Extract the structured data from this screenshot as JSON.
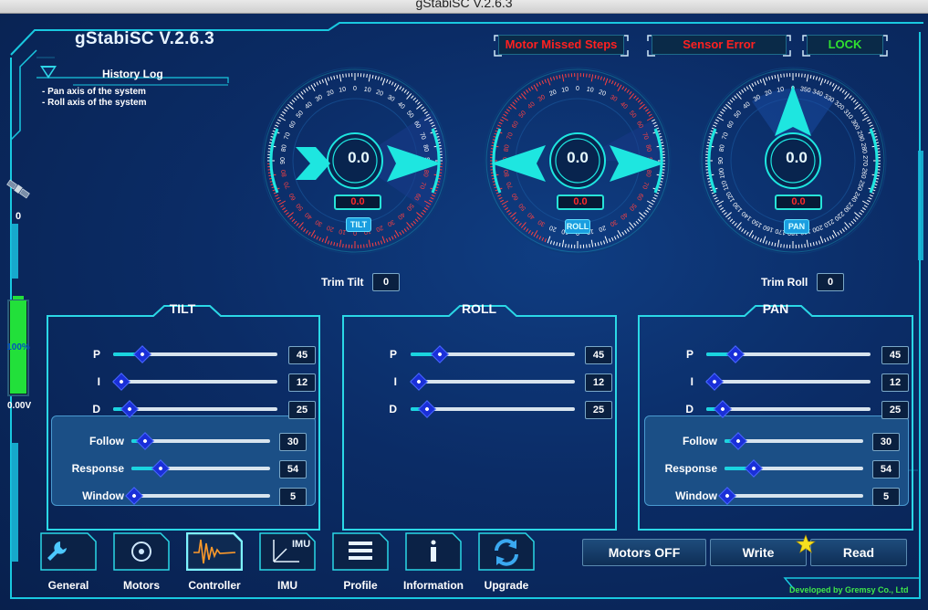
{
  "window": {
    "title": "gStabiSC V.2.6.3"
  },
  "app": {
    "title": "gStabiSC V.2.6.3",
    "credit": "Developed by Gremsy Co., Ltd"
  },
  "status": {
    "motor_missed": "Motor Missed Steps",
    "sensor_error": "Sensor Error",
    "lock": "LOCK"
  },
  "history": {
    "label": "History Log",
    "lines": [
      "- Pan axis of the system",
      "- Roll axis of the system"
    ]
  },
  "left": {
    "satellite_count": "0",
    "battery_percent": "100%",
    "battery_fraction": 1.0,
    "voltage": "0.00V"
  },
  "gauges": {
    "tilt": {
      "value": "0.0",
      "sub": "0.0",
      "tag": "TILT",
      "angle": 0
    },
    "roll": {
      "value": "0.0",
      "sub": "0.0",
      "tag": "ROLL",
      "angle": 0
    },
    "pan": {
      "value": "0.0",
      "sub": "0.0",
      "tag": "PAN",
      "angle": 0
    }
  },
  "trim": {
    "tilt_label": "Trim Tilt",
    "tilt_value": "0",
    "roll_label": "Trim Roll",
    "roll_value": "0"
  },
  "panels": {
    "tilt": {
      "title": "TILT",
      "pid": [
        {
          "label": "P",
          "value": "45",
          "level": 0.18
        },
        {
          "label": "I",
          "value": "12",
          "level": 0.05
        },
        {
          "label": "D",
          "value": "25",
          "level": 0.1
        }
      ],
      "extra": [
        {
          "label": "Follow",
          "value": "30",
          "level": 0.1
        },
        {
          "label": "Response",
          "value": "54",
          "level": 0.21
        },
        {
          "label": "Window",
          "value": "5",
          "level": 0.02
        }
      ]
    },
    "roll": {
      "title": "ROLL",
      "pid": [
        {
          "label": "P",
          "value": "45",
          "level": 0.18
        },
        {
          "label": "I",
          "value": "12",
          "level": 0.05
        },
        {
          "label": "D",
          "value": "25",
          "level": 0.1
        }
      ]
    },
    "pan": {
      "title": "PAN",
      "pid": [
        {
          "label": "P",
          "value": "45",
          "level": 0.18
        },
        {
          "label": "I",
          "value": "12",
          "level": 0.05
        },
        {
          "label": "D",
          "value": "25",
          "level": 0.1
        }
      ],
      "extra": [
        {
          "label": "Follow",
          "value": "30",
          "level": 0.1
        },
        {
          "label": "Response",
          "value": "54",
          "level": 0.21
        },
        {
          "label": "Window",
          "value": "5",
          "level": 0.02
        }
      ]
    }
  },
  "nav": [
    {
      "label": "General",
      "icon": "wrench-icon"
    },
    {
      "label": "Motors",
      "icon": "motor-icon"
    },
    {
      "label": "Controller",
      "icon": "waveform-icon"
    },
    {
      "label": "IMU",
      "icon": "imu-axes-icon"
    },
    {
      "label": "Profile",
      "icon": "list-icon"
    },
    {
      "label": "Information",
      "icon": "info-icon"
    },
    {
      "label": "Upgrade",
      "icon": "refresh-icon"
    }
  ],
  "actions": {
    "motors_off": "Motors OFF",
    "write": "Write",
    "read": "Read"
  },
  "colors": {
    "accent": "#1ee6e0",
    "warning": "#ff2020",
    "ok": "#30e030",
    "knob": "#1a2fd8"
  }
}
